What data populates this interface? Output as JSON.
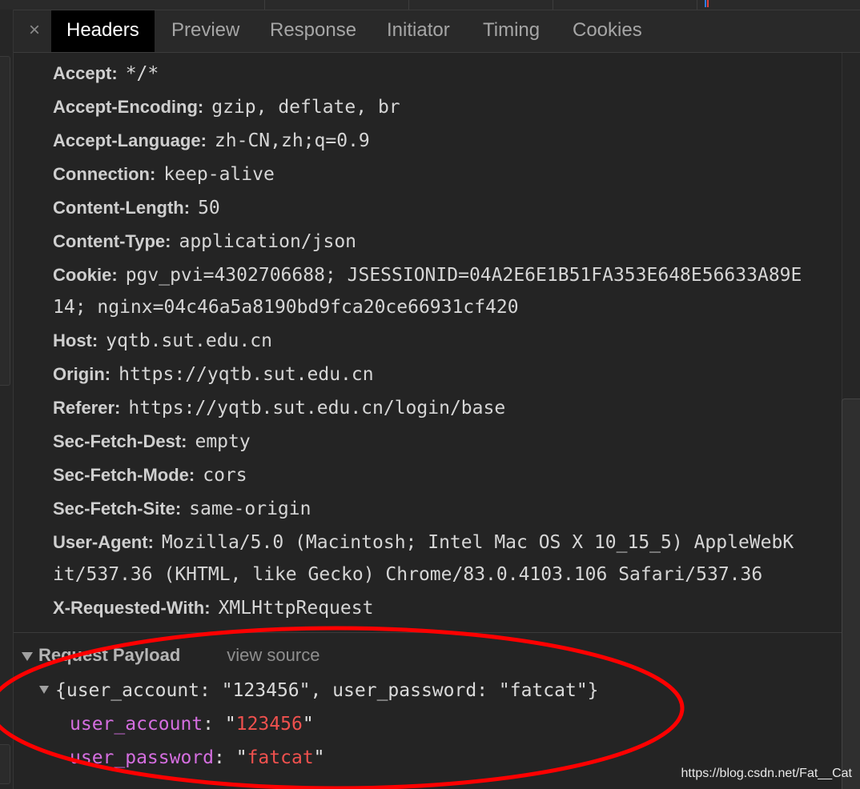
{
  "tabs": {
    "close_glyph": "×",
    "items": [
      "Headers",
      "Preview",
      "Response",
      "Initiator",
      "Timing",
      "Cookies"
    ],
    "active": "Headers"
  },
  "headers": [
    {
      "name": "Accept:",
      "value": "*/*"
    },
    {
      "name": "Accept-Encoding:",
      "value": "gzip, deflate, br"
    },
    {
      "name": "Accept-Language:",
      "value": "zh-CN,zh;q=0.9"
    },
    {
      "name": "Connection:",
      "value": "keep-alive"
    },
    {
      "name": "Content-Length:",
      "value": "50"
    },
    {
      "name": "Content-Type:",
      "value": "application/json"
    },
    {
      "name": "Cookie:",
      "value": "pgv_pvi=4302706688; JSESSIONID=04A2E6E1B51FA353E648E56633A89E",
      "cont": "14; nginx=04c46a5a8190bd9fca20ce66931cf420"
    },
    {
      "name": "Host:",
      "value": "yqtb.sut.edu.cn"
    },
    {
      "name": "Origin:",
      "value": "https://yqtb.sut.edu.cn"
    },
    {
      "name": "Referer:",
      "value": "https://yqtb.sut.edu.cn/login/base"
    },
    {
      "name": "Sec-Fetch-Dest:",
      "value": "empty"
    },
    {
      "name": "Sec-Fetch-Mode:",
      "value": "cors"
    },
    {
      "name": "Sec-Fetch-Site:",
      "value": "same-origin"
    },
    {
      "name": "User-Agent:",
      "value": "Mozilla/5.0 (Macintosh; Intel Mac OS X 10_15_5) AppleWebK",
      "cont": "it/537.36 (KHTML, like Gecko) Chrome/83.0.4103.106 Safari/537.36"
    },
    {
      "name": "X-Requested-With:",
      "value": "XMLHttpRequest"
    }
  ],
  "payload": {
    "title": "Request Payload",
    "view_source": "view source",
    "summary": "{user_account: \"123456\", user_password: \"fatcat\"}",
    "props": [
      {
        "key": "user_account",
        "value": "123456"
      },
      {
        "key": "user_password",
        "value": "fatcat"
      }
    ]
  },
  "watermark": "https://blog.csdn.net/Fat__Cat",
  "colors": {
    "annotation": "#ff0000",
    "key": "#d56ee0",
    "string": "#f0514e"
  }
}
